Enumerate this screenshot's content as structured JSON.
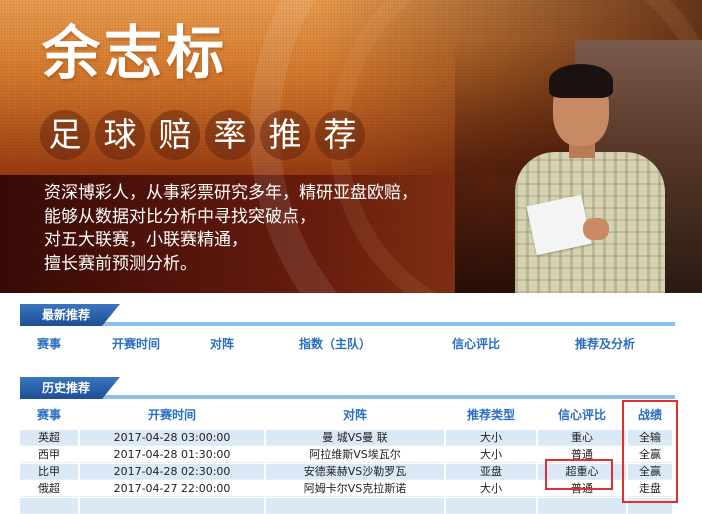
{
  "banner": {
    "name": "余志标",
    "subtitle_chars": [
      "足",
      "球",
      "赔",
      "率",
      "推",
      "荐"
    ],
    "intro_lines": [
      "资深博彩人，从事彩票研究多年，精研亚盘欧赔，",
      "能够从数据对比分析中寻找突破点，",
      "对五大联赛，小联赛精通，",
      "擅长赛前预测分析。"
    ]
  },
  "latest": {
    "title": "最新推荐",
    "columns": [
      "赛事",
      "开赛时间",
      "对阵",
      "指数（主队）",
      "信心评比",
      "推荐及分析"
    ]
  },
  "history": {
    "title": "历史推荐",
    "columns": [
      "赛事",
      "开赛时间",
      "对阵",
      "推荐类型",
      "信心评比",
      "战绩"
    ],
    "rows": [
      [
        "英超",
        "2017-04-28 03:00:00",
        "曼 城VS曼 联",
        "大小",
        "重心",
        "全输"
      ],
      [
        "西甲",
        "2017-04-28 01:30:00",
        "阿拉维斯VS埃瓦尔",
        "大小",
        "普通",
        "全赢"
      ],
      [
        "比甲",
        "2017-04-28 02:30:00",
        "安德莱赫VS沙勒罗瓦",
        "亚盘",
        "超重心",
        "全赢"
      ],
      [
        "俄超",
        "2017-04-27 22:00:00",
        "阿姆卡尔VS克拉斯诺",
        "大小",
        "普通",
        "走盘"
      ]
    ]
  },
  "colors": {
    "header_blue": "#2a6fc2",
    "row_shade": "#dbe9f7",
    "highlight_red": "#e03030"
  }
}
